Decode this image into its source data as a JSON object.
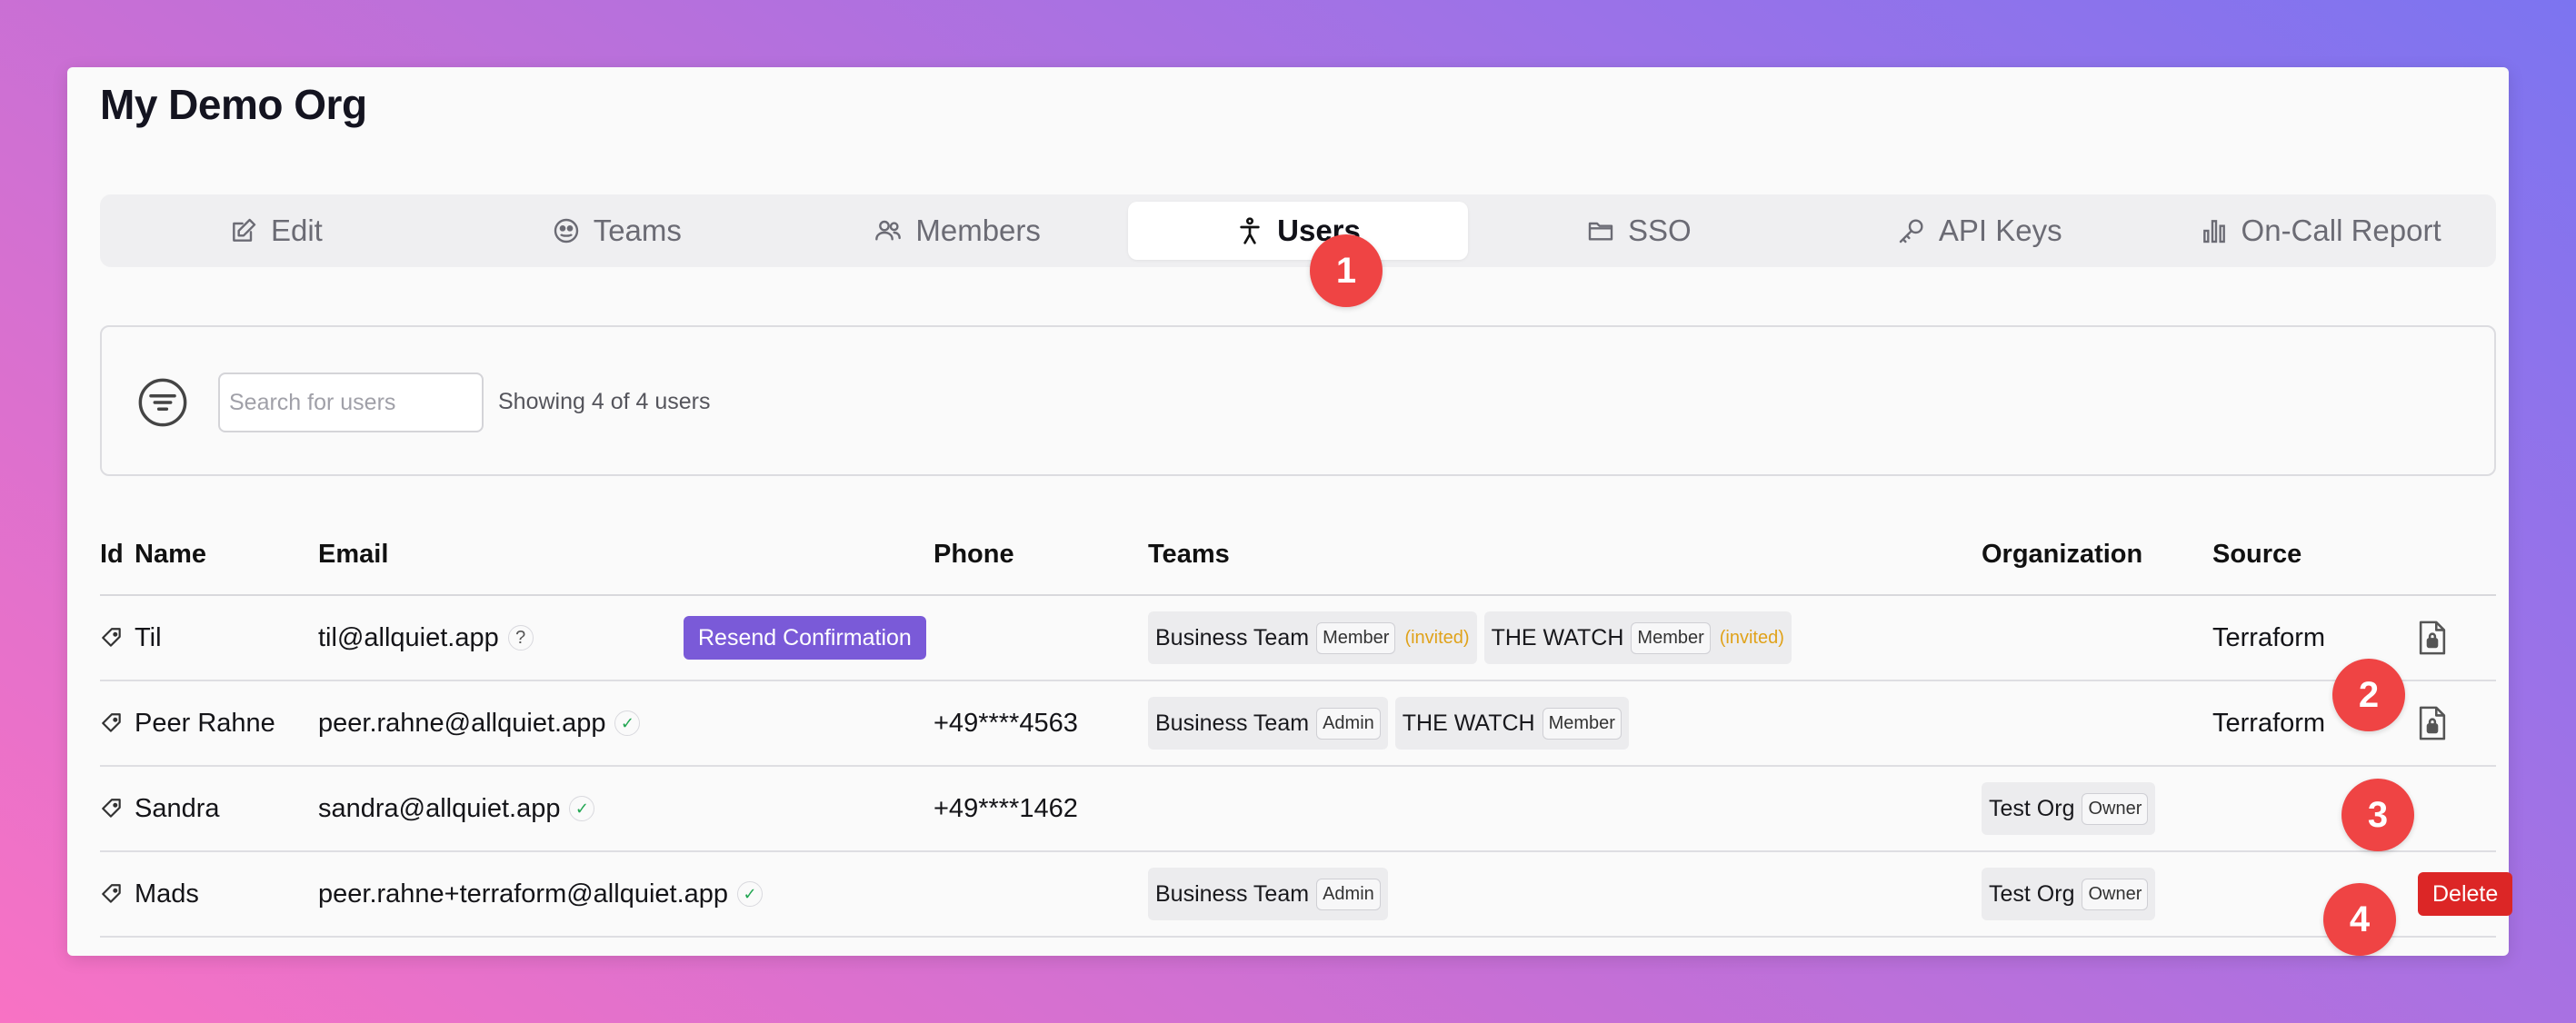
{
  "org": {
    "title": "My Demo Org"
  },
  "tabs": [
    {
      "label": "Edit",
      "icon": "edit-icon"
    },
    {
      "label": "Teams",
      "icon": "teams-icon"
    },
    {
      "label": "Members",
      "icon": "members-icon"
    },
    {
      "label": "Users",
      "icon": "user-icon",
      "active": true
    },
    {
      "label": "SSO",
      "icon": "folder-icon"
    },
    {
      "label": "API Keys",
      "icon": "key-icon"
    },
    {
      "label": "On-Call Report",
      "icon": "bar-chart-icon"
    }
  ],
  "filter": {
    "search_placeholder": "Search for users",
    "showing_text": "Showing 4 of 4 users"
  },
  "table": {
    "columns": [
      "Id",
      "Name",
      "Email",
      "Phone",
      "Teams",
      "Organization",
      "Source"
    ],
    "rows": [
      {
        "name": "Til",
        "email": "til@allquiet.app",
        "email_status": "?",
        "action": "Resend Confirmation",
        "phone": "",
        "teams": [
          {
            "name": "Business Team",
            "role": "Member",
            "status": "(invited)"
          },
          {
            "name": "THE WATCH",
            "role": "Member",
            "status": "(invited)"
          }
        ],
        "organization": null,
        "source": "Terraform"
      },
      {
        "name": "Peer Rahne",
        "email": "peer.rahne@allquiet.app",
        "email_status": "✓",
        "phone": "+49****4563",
        "teams": [
          {
            "name": "Business Team",
            "role": "Admin"
          },
          {
            "name": "THE WATCH",
            "role": "Member"
          }
        ],
        "organization": null,
        "source": "Terraform"
      },
      {
        "name": "Sandra",
        "email": "sandra@allquiet.app",
        "email_status": "✓",
        "phone": "+49****1462",
        "teams": [],
        "organization": {
          "name": "Test Org",
          "role": "Owner"
        },
        "source": ""
      },
      {
        "name": "Mads",
        "email": "peer.rahne+terraform@allquiet.app",
        "email_status": "✓",
        "phone": "",
        "teams": [
          {
            "name": "Business Team",
            "role": "Admin"
          }
        ],
        "organization": {
          "name": "Test Org",
          "role": "Owner"
        },
        "source": "",
        "action": "Delete"
      }
    ]
  },
  "badges": [
    "1",
    "2",
    "3",
    "4"
  ],
  "colors": {
    "accent": "#7a5ad8",
    "danger": "#dc2626",
    "badge": "#ef4444",
    "invited": "#e0a21a",
    "verified": "#22a652"
  }
}
